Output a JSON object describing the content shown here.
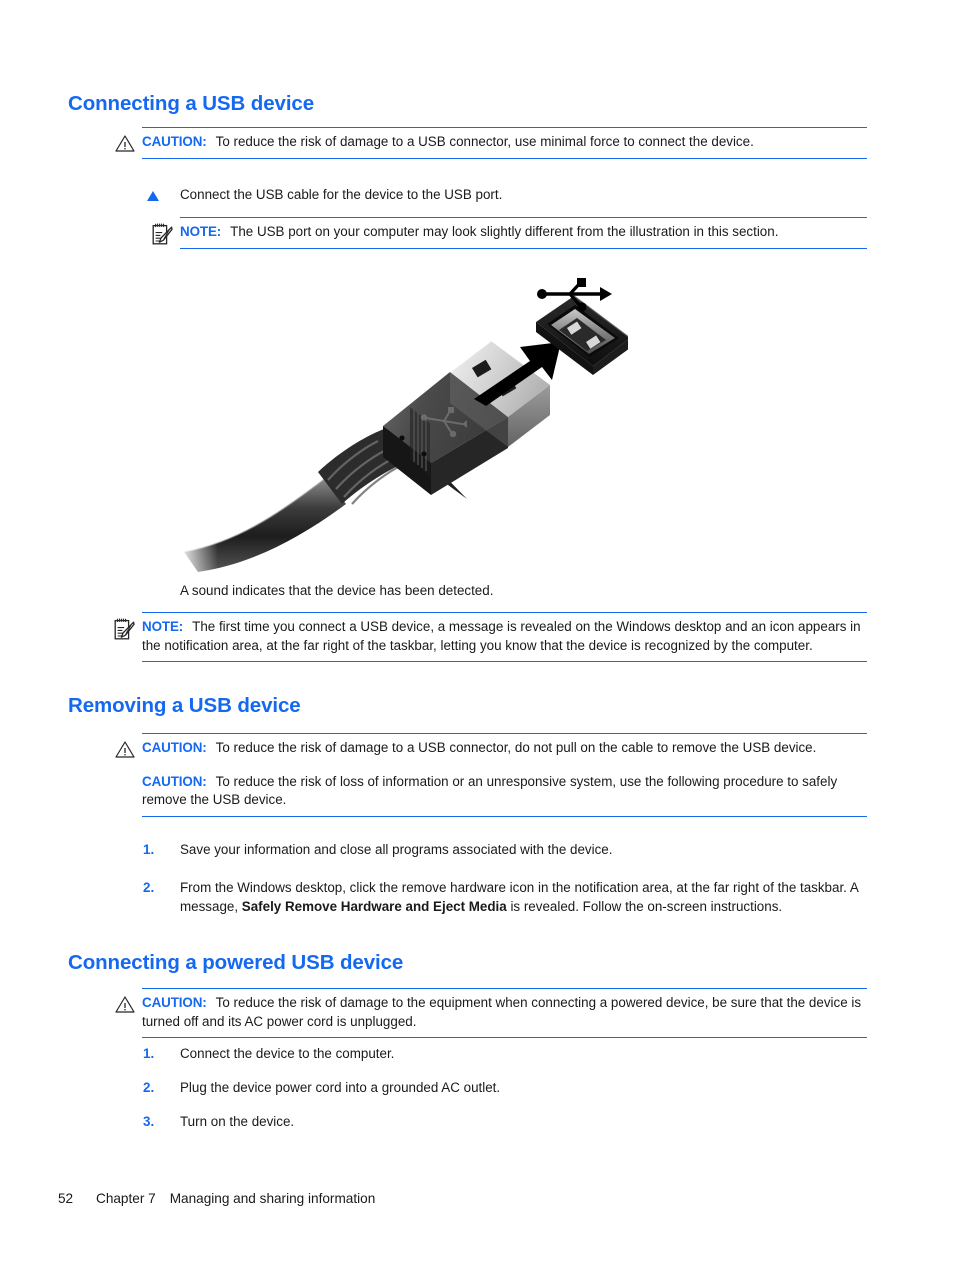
{
  "page": {
    "number": "52",
    "chapter": "Chapter 7",
    "chapter_title": "Managing and sharing information",
    "accent_blue": "#1569f0",
    "text_color": "#1a1a1a"
  },
  "sections": {
    "connecting": {
      "heading": "Connecting a USB device",
      "caution": {
        "label": "CAUTION:",
        "text": "To reduce the risk of damage to a USB connector, use minimal force to connect the device."
      },
      "step": "Connect the USB cable for the device to the USB port.",
      "note": {
        "label": "NOTE:",
        "text": "The USB port on your computer may look slightly different from the illustration in this section."
      },
      "figure": {
        "alt": "USB cable plug being inserted into a USB port",
        "usb_symbol": "usb-trident-symbol"
      },
      "caption": "A sound indicates that the device has been detected.",
      "note2": {
        "label": "NOTE:",
        "text": "The first time you connect a USB device, a message is revealed on the Windows desktop and an icon appears in the notification area, at the far right of the taskbar, letting you know that the device is recognized by the computer."
      }
    },
    "removing": {
      "heading": "Removing a USB device",
      "caution1": {
        "label": "CAUTION:",
        "text": "To reduce the risk of damage to a USB connector, do not pull on the cable to remove the USB device."
      },
      "caution2": {
        "label": "CAUTION:",
        "text": "To reduce the risk of loss of information or an unresponsive system, use the following procedure to safely remove the USB device."
      },
      "steps": [
        {
          "num": "1.",
          "text": "Save your information and close all programs associated with the device."
        },
        {
          "num": "2.",
          "text_before": "From the Windows desktop, click the remove hardware icon in the notification area, at the far right of the taskbar. A message, ",
          "text_bold": "Safely Remove Hardware and Eject Media",
          "text_after": " is revealed. Follow the on-screen instructions."
        }
      ]
    },
    "powered": {
      "heading": "Connecting a powered USB device",
      "caution": {
        "label": "CAUTION:",
        "text": "To reduce the risk of damage to the equipment when connecting a powered device, be sure that the device is turned off and its AC power cord is unplugged."
      },
      "steps": [
        {
          "num": "1.",
          "text": "Connect the device to the computer."
        },
        {
          "num": "2.",
          "text": "Plug the device power cord into a grounded AC outlet."
        },
        {
          "num": "3.",
          "text": "Turn on the device."
        }
      ]
    }
  }
}
